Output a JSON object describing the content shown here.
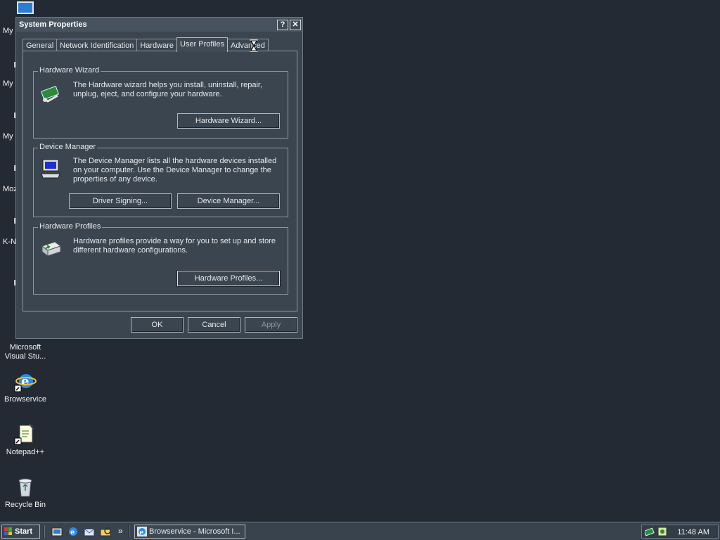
{
  "desktop": {
    "left_clipped_labels": [
      "My",
      "My D",
      "My",
      "Moz",
      "K-N"
    ],
    "icons": [
      {
        "label": "Microsoft Visual Stu...",
        "icon": "visual-studio-icon"
      },
      {
        "label": "Browservice",
        "icon": "internet-explorer-icon"
      },
      {
        "label": "Notepad++",
        "icon": "notepad-icon"
      },
      {
        "label": "Recycle Bin",
        "icon": "recycle-bin-icon"
      }
    ]
  },
  "dialog": {
    "title": "System Properties",
    "help_glyph": "?",
    "close_glyph": "✕",
    "tabs": [
      "General",
      "Network Identification",
      "Hardware",
      "User Profiles",
      "Advanced"
    ],
    "active_tab": "User Profiles",
    "groups": {
      "hardware_wizard": {
        "title": "Hardware Wizard",
        "desc": "The Hardware wizard helps you install, uninstall, repair, unplug, eject, and configure your hardware.",
        "button": "Hardware Wizard..."
      },
      "device_manager": {
        "title": "Device Manager",
        "desc": "The Device Manager lists all the hardware devices installed on your computer. Use the Device Manager to change the properties of any device.",
        "button_driver": "Driver Signing...",
        "button_device": "Device Manager..."
      },
      "hardware_profiles": {
        "title": "Hardware Profiles",
        "desc": "Hardware profiles provide a way for you to set up and store different hardware configurations.",
        "button": "Hardware Profiles..."
      }
    },
    "ok": "OK",
    "cancel": "Cancel",
    "apply": "Apply"
  },
  "taskbar": {
    "start": "Start",
    "overflow": "»",
    "task_label": "Browservice - Microsoft I...",
    "clock": "11:48 AM"
  },
  "colors": {
    "desktop_bg": "#232a33",
    "dialog_bg": "#3a4550",
    "border": "#8c97a1"
  }
}
